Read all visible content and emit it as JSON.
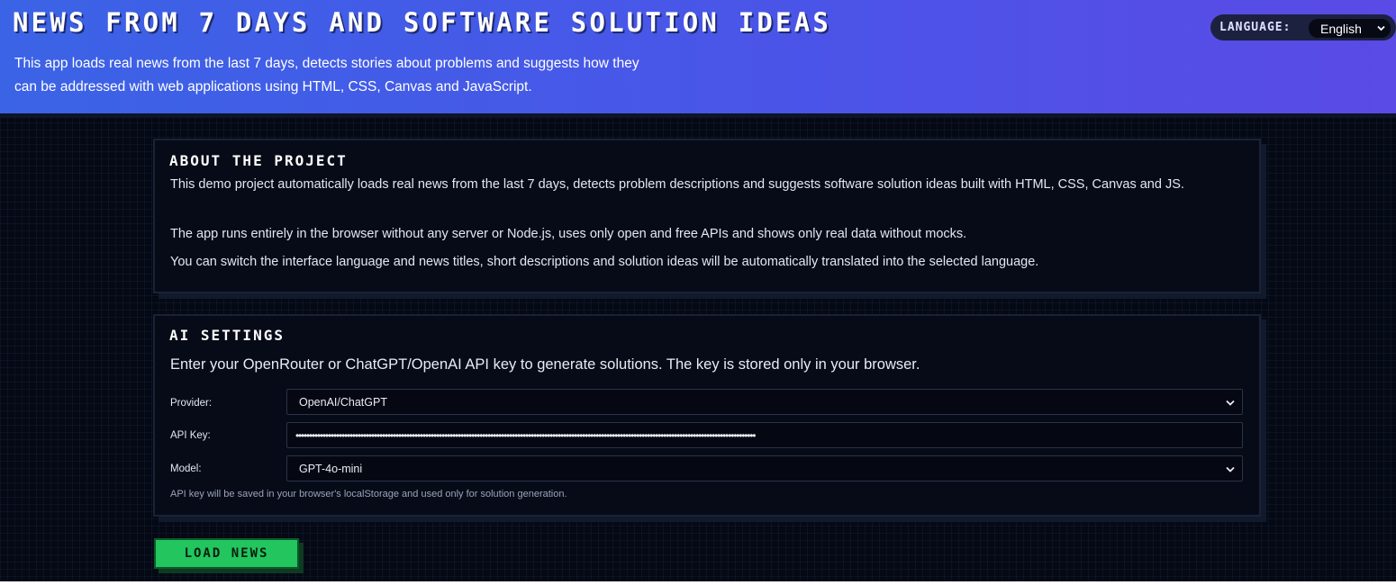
{
  "header": {
    "title": "NEWS FROM 7 DAYS AND SOFTWARE SOLUTION IDEAS",
    "subtitle": "This app loads real news from the last 7 days, detects stories about problems and suggests how they can be addressed with web applications using HTML, CSS, Canvas and JavaScript.",
    "language_label": "LANGUAGE:",
    "language_value": "English"
  },
  "about": {
    "heading": "ABOUT THE PROJECT",
    "paragraphs": [
      "This demo project automatically loads real news from the last 7 days, detects problem descriptions and suggests software solution ideas built with HTML, CSS, Canvas and JS.",
      "The app runs entirely in the browser without any server or Node.js, uses only open and free APIs and shows only real data without mocks.",
      "You can switch the interface language and news titles, short descriptions and solution ideas will be automatically translated into the selected language."
    ]
  },
  "ai_settings": {
    "heading": "AI SETTINGS",
    "description": "Enter your OpenRouter or ChatGPT/OpenAI API key to generate solutions. The key is stored only in your browser.",
    "provider_label": "Provider:",
    "provider_value": "OpenAI/ChatGPT",
    "api_key_label": "API Key:",
    "api_key_value": "••••••••••••••••••••••••••••••••••••••••••••••••••••••••••••••••••••••••••••••••••••••••••••••••••••••••••••••••••••••••••••••••••••••••••••••••••••••••••••••••••••••••••",
    "model_label": "Model:",
    "model_value": "GPT-4o-mini",
    "note": "API key will be saved in your browser's localStorage and used only for solution generation."
  },
  "actions": {
    "load_news_label": "LOAD NEWS"
  },
  "colors": {
    "header_gradient_start": "#3b63e6",
    "header_gradient_end": "#5a4ae6",
    "background": "#050914",
    "panel": "#070b18",
    "button_green": "#22c55e"
  },
  "icons": {
    "language_select": "chevron-down-icon",
    "provider_select": "chevron-down-icon",
    "model_select": "chevron-down-icon"
  }
}
